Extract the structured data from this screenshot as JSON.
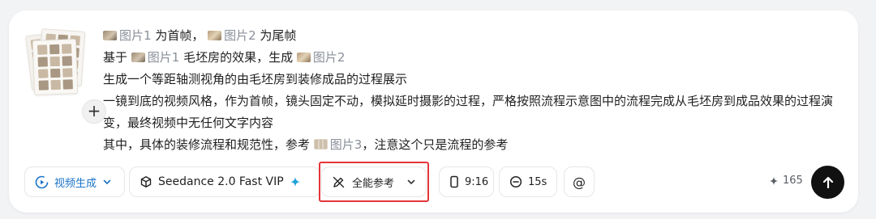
{
  "prompt": {
    "line1": {
      "ref1": "图片1",
      "t1": " 为首帧，",
      "ref2": "图片2",
      "t2": " 为尾帧"
    },
    "line2": {
      "t0": "基于 ",
      "ref1": "图片1",
      "t1": " 毛坯房的效果，生成 ",
      "ref2": "图片2"
    },
    "line3": "生成一个等距轴测视角的由毛坯房到装修成品的过程展示",
    "line4": "一镜到底的视频风格，作为首帧，镜头固定不动，模拟延时摄影的过程，严格按照流程示意图中的流程完成从毛坯房到成品效果的过程演变，最终视频中无任何文字内容",
    "line5": {
      "t0": "其中，具体的装修流程和规范性，参考 ",
      "ref3": "图片3",
      "t1": "，注意这个只是流程的参考"
    }
  },
  "toolbar": {
    "mode_label": "视频生成",
    "model_label": "Seedance 2.0 Fast VIP",
    "reference_label": "全能参考",
    "ratio_label": "9:16",
    "duration_label": "15s",
    "mention_label": "@",
    "credits": "165"
  },
  "icons": {
    "mode": "video-play-icon",
    "mode_chevron": "chevron-down-icon",
    "model": "cube-icon",
    "model_badge": "sparkle-icon",
    "reference": "pencil-slash-icon",
    "reference_chevron": "chevron-down-icon",
    "ratio": "phone-portrait-icon",
    "duration": "clock-icon",
    "credits": "sparkle-icon",
    "send": "arrow-up-icon",
    "add": "plus-icon"
  },
  "colors": {
    "accent_blue": "#1a73c8",
    "highlight_red": "#e5353a",
    "send_bg": "#111111",
    "reference_text": "#8a8f99"
  }
}
